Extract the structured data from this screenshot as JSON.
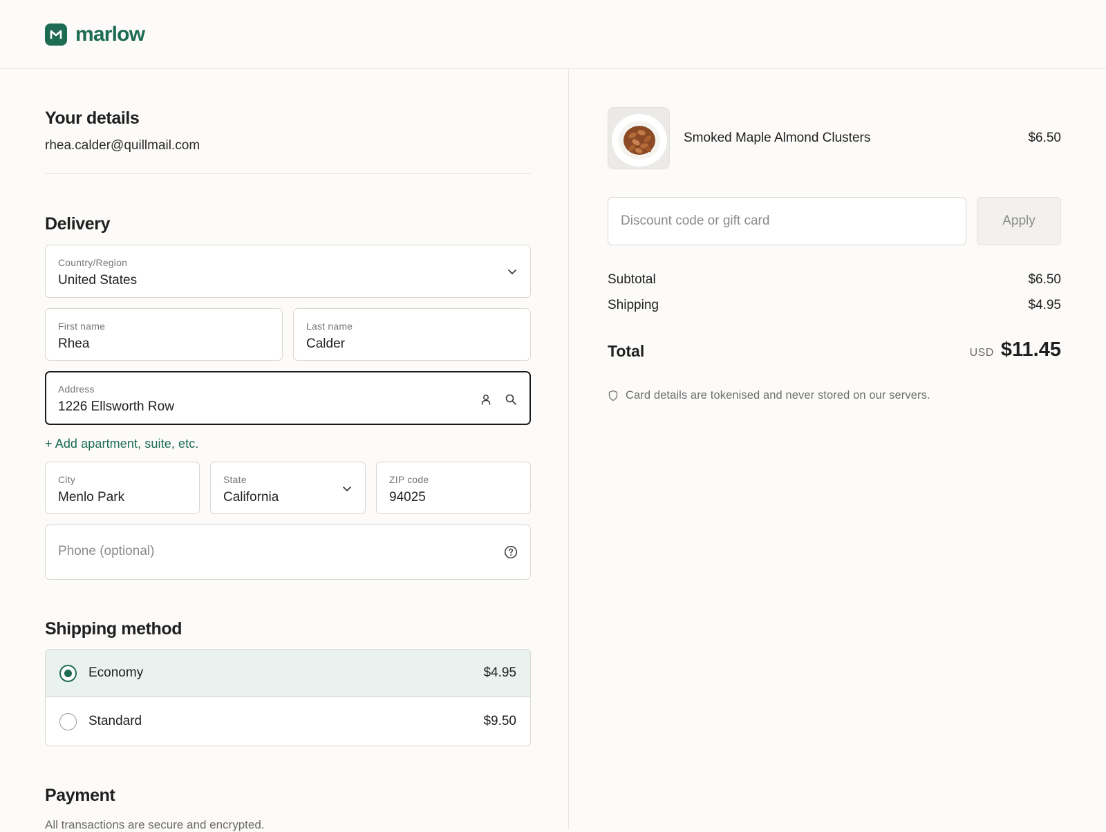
{
  "brand": {
    "name": "marlow",
    "color": "#1c6b52"
  },
  "details": {
    "title": "Your details",
    "email": "rhea.calder@quillmail.com"
  },
  "delivery": {
    "title": "Delivery",
    "country": {
      "label": "Country/Region",
      "value": "United States"
    },
    "first_name": {
      "label": "First name",
      "value": "Rhea"
    },
    "last_name": {
      "label": "Last name",
      "value": "Calder"
    },
    "address": {
      "label": "Address",
      "value": "1226 Ellsworth Row"
    },
    "add_apartment": "+ Add apartment, suite, etc.",
    "city": {
      "label": "City",
      "value": "Menlo Park"
    },
    "state": {
      "label": "State",
      "value": "California"
    },
    "zip": {
      "label": "ZIP code",
      "value": "94025"
    },
    "phone": {
      "placeholder": "Phone (optional)"
    }
  },
  "shipping": {
    "title": "Shipping method",
    "options": [
      {
        "name": "Economy",
        "price": "$4.95",
        "selected": true
      },
      {
        "name": "Standard",
        "price": "$9.50",
        "selected": false
      }
    ]
  },
  "payment": {
    "title": "Payment",
    "subtitle": "All transactions are secure and encrypted."
  },
  "order": {
    "product": {
      "name": "Smoked Maple Almond Clusters",
      "price": "$6.50"
    },
    "discount_placeholder": "Discount code or gift card",
    "apply_label": "Apply",
    "subtotal_label": "Subtotal",
    "subtotal_value": "$6.50",
    "shipping_label": "Shipping",
    "shipping_value": "$4.95",
    "total_label": "Total",
    "currency": "USD",
    "total_value": "$11.45",
    "security_note": "Card details are tokenised and never stored on our servers."
  }
}
